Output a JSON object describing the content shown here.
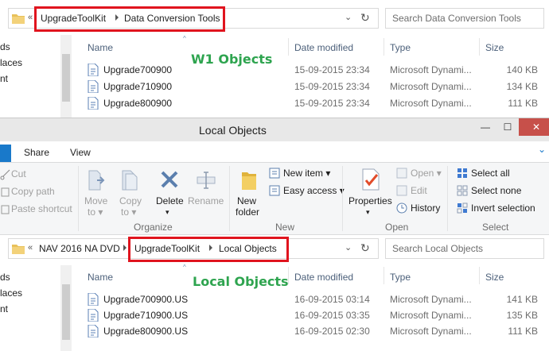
{
  "top_window": {
    "breadcrumb_back": "«",
    "breadcrumb": [
      "UpgradeToolKit",
      "Data Conversion Tools"
    ],
    "search_placeholder": "Search Data Conversion Tools",
    "nav_items": [
      "ds",
      "laces",
      "nt"
    ],
    "columns": {
      "name": "Name",
      "date": "Date modified",
      "type": "Type",
      "size": "Size"
    },
    "annotation": "W1 Objects",
    "files": [
      {
        "name": "Upgrade700900",
        "date": "15-09-2015 23:34",
        "type": "Microsoft Dynami...",
        "size": "140 KB"
      },
      {
        "name": "Upgrade710900",
        "date": "15-09-2015 23:34",
        "type": "Microsoft Dynami...",
        "size": "134 KB"
      },
      {
        "name": "Upgrade800900",
        "date": "15-09-2015 23:34",
        "type": "Microsoft Dynami...",
        "size": "111 KB"
      }
    ]
  },
  "bottom_window": {
    "title": "Local Objects",
    "controls": {
      "minimize": "—",
      "maximize": "☐",
      "close": "✕"
    },
    "menu": {
      "share": "Share",
      "view": "View",
      "expand": "⌄"
    },
    "ribbon": {
      "clipboard": {
        "cut": "Cut",
        "copy_path": "Copy path",
        "paste_shortcut": "Paste shortcut"
      },
      "organize": {
        "move_to": [
          "Move",
          "to ▾"
        ],
        "copy_to": [
          "Copy",
          "to ▾"
        ],
        "delete": [
          "Delete",
          "▾"
        ],
        "rename": "Rename",
        "label": "Organize"
      },
      "new": {
        "new_folder": [
          "New",
          "folder"
        ],
        "new_item": "New item ▾",
        "easy_access": "Easy access ▾",
        "label": "New"
      },
      "open": {
        "properties": [
          "Properties",
          "▾"
        ],
        "open": "Open ▾",
        "edit": "Edit",
        "history": "History",
        "label": "Open"
      },
      "select": {
        "select_all": "Select all",
        "select_none": "Select none",
        "invert_selection": "Invert selection",
        "label": "Select"
      }
    },
    "breadcrumb_back": "«",
    "breadcrumb_prefix": "NAV 2016 NA DVD",
    "breadcrumb": [
      "UpgradeToolKit",
      "Local Objects"
    ],
    "search_placeholder": "Search Local Objects",
    "nav_items": [
      "ds",
      "laces",
      "nt"
    ],
    "columns": {
      "name": "Name",
      "date": "Date modified",
      "type": "Type",
      "size": "Size"
    },
    "annotation": "Local Objects",
    "files": [
      {
        "name": "Upgrade700900.US",
        "date": "16-09-2015 03:14",
        "type": "Microsoft Dynami...",
        "size": "141 KB"
      },
      {
        "name": "Upgrade710900.US",
        "date": "16-09-2015 03:35",
        "type": "Microsoft Dynami...",
        "size": "135 KB"
      },
      {
        "name": "Upgrade800900.US",
        "date": "16-09-2015 02:30",
        "type": "Microsoft Dynami...",
        "size": "111 KB"
      }
    ]
  },
  "colors": {
    "highlight_box": "#e0141e",
    "annotation_green": "#2ea44f",
    "file_tab_blue": "#1979ca"
  }
}
